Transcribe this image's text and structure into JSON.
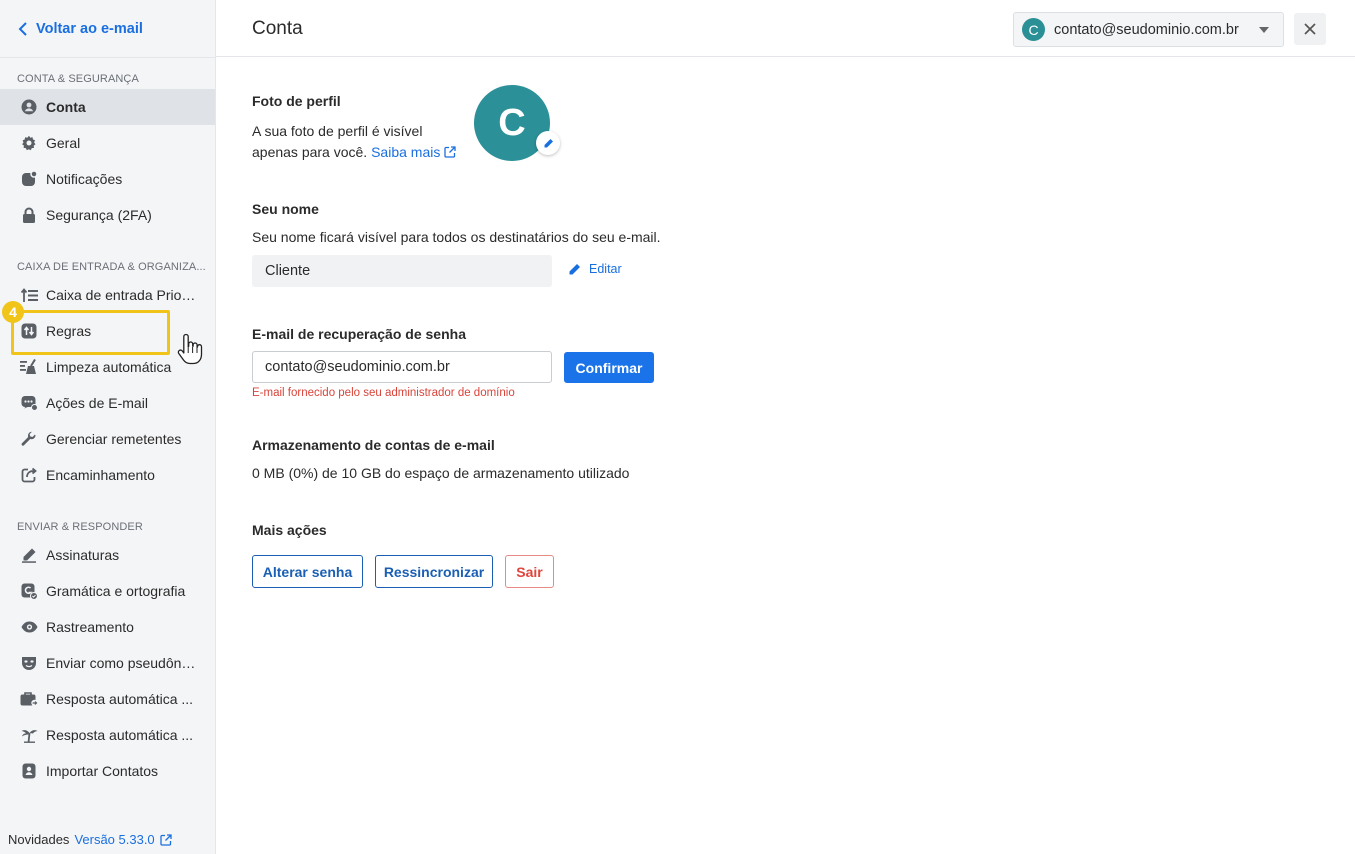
{
  "sidebar": {
    "back_label": "Voltar ao e-mail",
    "sections": [
      {
        "title": "CONTA & SEGURANÇA",
        "items": [
          {
            "label": "Conta",
            "icon": "user-circle-icon"
          },
          {
            "label": "Geral",
            "icon": "gear-icon"
          },
          {
            "label": "Notificações",
            "icon": "notification-icon"
          },
          {
            "label": "Segurança (2FA)",
            "icon": "lock-icon"
          }
        ]
      },
      {
        "title": "CAIXA DE ENTRADA & ORGANIZA...",
        "items": [
          {
            "label": "Caixa de entrada Prior...",
            "icon": "priority-list-icon"
          },
          {
            "label": "Regras",
            "icon": "rules-icon"
          },
          {
            "label": "Limpeza automática",
            "icon": "broom-icon"
          },
          {
            "label": "Ações de E-mail",
            "icon": "email-actions-icon"
          },
          {
            "label": "Gerenciar remetentes",
            "icon": "wrench-icon"
          },
          {
            "label": "Encaminhamento",
            "icon": "forward-icon"
          }
        ]
      },
      {
        "title": "ENVIAR & RESPONDER",
        "items": [
          {
            "label": "Assinaturas",
            "icon": "pen-icon"
          },
          {
            "label": "Gramática e ortografia",
            "icon": "grammar-icon"
          },
          {
            "label": "Rastreamento",
            "icon": "eye-icon"
          },
          {
            "label": "Enviar como pseudôni...",
            "icon": "mask-icon"
          },
          {
            "label": "Resposta automática ...",
            "icon": "briefcase-icon"
          },
          {
            "label": "Resposta automática ...",
            "icon": "palm-tree-icon"
          },
          {
            "label": "Importar Contatos",
            "icon": "contacts-icon"
          }
        ]
      }
    ],
    "step_badge": "4",
    "footer_label": "Novidades",
    "version_label": "Versão 5.33.0"
  },
  "header": {
    "title": "Conta",
    "account_initial": "C",
    "account_email": "contato@seudominio.com.br"
  },
  "profile_photo": {
    "heading": "Foto de perfil",
    "desc_line1": "A sua foto de perfil é visível",
    "desc_line2": "apenas para você.",
    "learn_more": "Saiba mais",
    "avatar_initial": "C"
  },
  "name": {
    "heading": "Seu nome",
    "desc": "Seu nome ficará visível para todos os destinatários do seu e-mail.",
    "value": "Cliente",
    "edit_label": "Editar"
  },
  "recovery": {
    "heading": "E-mail de recuperação de senha",
    "value": "contato@seudominio.com.br",
    "confirm_label": "Confirmar",
    "error": "E-mail fornecido pelo seu administrador de domínio"
  },
  "storage": {
    "heading": "Armazenamento de contas de e-mail",
    "desc": "0 MB (0%) de 10 GB do espaço de armazenamento utilizado"
  },
  "more_actions": {
    "heading": "Mais ações",
    "change_password": "Alterar senha",
    "resync": "Ressincronizar",
    "sign_out": "Sair"
  },
  "colors": {
    "accent": "#1a73e8",
    "avatar": "#2b9098",
    "highlight": "#f0c419",
    "error": "#d9443a"
  }
}
